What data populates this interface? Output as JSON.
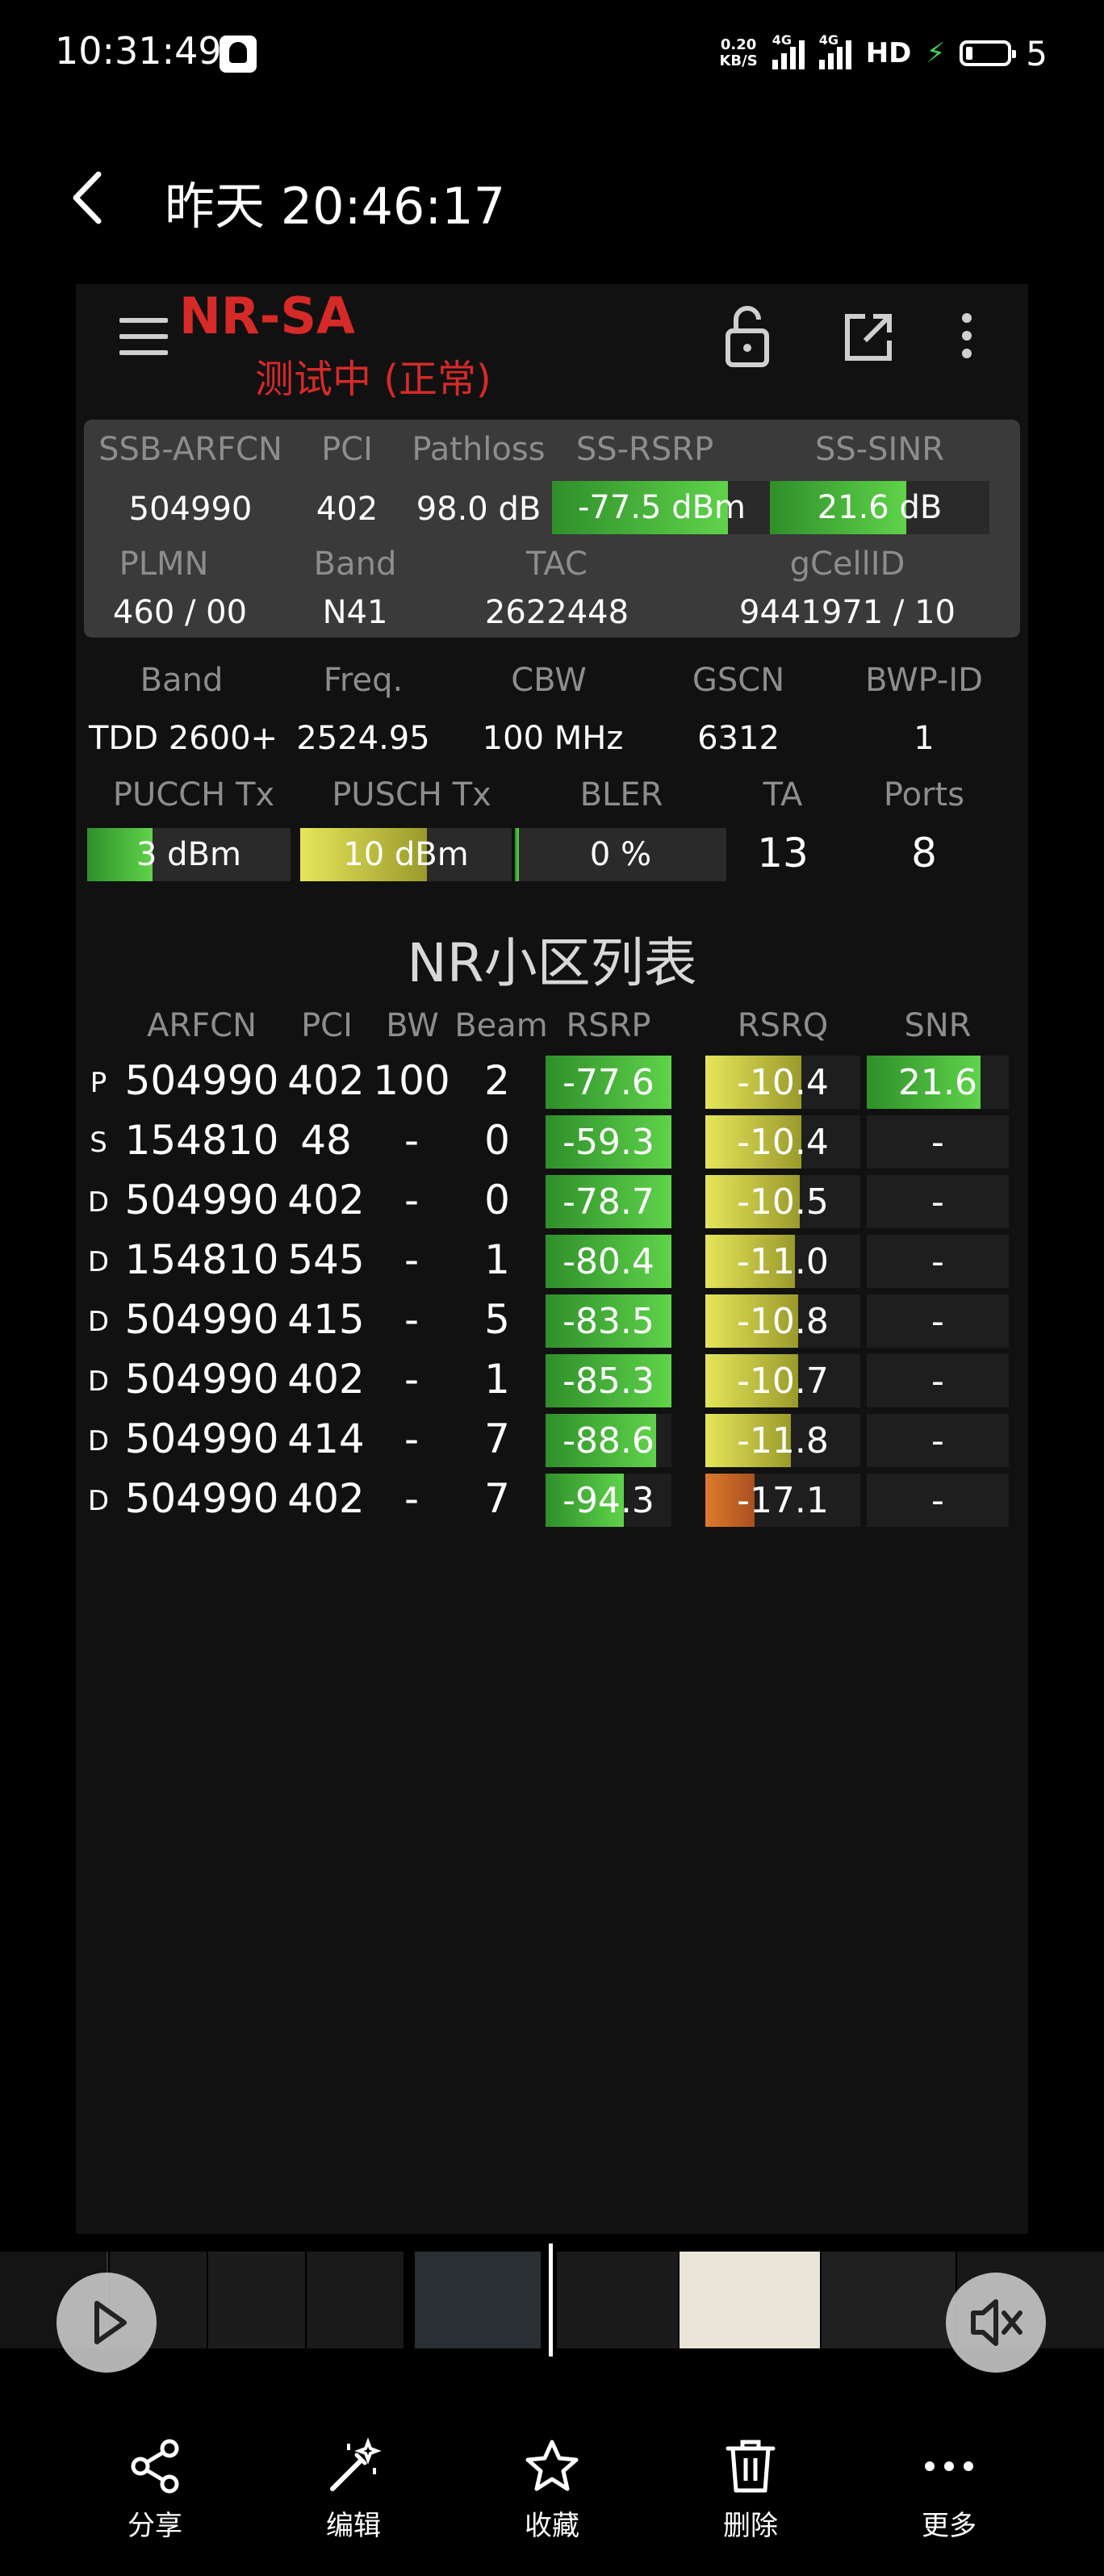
{
  "status_bar": {
    "time": "10:31:49",
    "net_speed_value": "0.20",
    "net_speed_unit": "KB/S",
    "sig1_label": "4G",
    "sig2_label": "4G",
    "hd_label": "HD",
    "battery_level": "5"
  },
  "header": {
    "title": "昨天 20:46:17"
  },
  "app": {
    "title": "NR-SA",
    "subtitle": "测试中 (正常)",
    "summary": {
      "labels": [
        "SSB-ARFCN",
        "PCI",
        "Pathloss",
        "SS-RSRP",
        "SS-SINR"
      ],
      "values": [
        "504990",
        "402",
        "98.0 dB",
        "-77.5 dBm",
        "21.6 dB"
      ],
      "rsrp_fill": 0.8,
      "sinr_fill": 0.62,
      "labels2": [
        "PLMN",
        "Band",
        "TAC",
        "gCellID"
      ],
      "values2": [
        "460 / 00",
        "N41",
        "2622448",
        "9441971 / 10"
      ]
    },
    "band_info": {
      "labels": [
        "Band",
        "Freq.",
        "CBW",
        "GSCN",
        "BWP-ID"
      ],
      "values": [
        "TDD 2600+",
        "2524.95",
        "100 MHz",
        "6312",
        "1"
      ]
    },
    "tx_info": {
      "labels": [
        "PUCCH Tx",
        "PUSCH Tx",
        "BLER",
        "TA",
        "Ports"
      ],
      "pucch": "3 dBm",
      "pusch": "10 dBm",
      "bler": "0 %",
      "ta": "13",
      "ports": "8",
      "pucch_fill": 0.32,
      "pusch_fill": 0.6,
      "bler_fill": 0.02
    },
    "cell_list": {
      "title": "NR小区列表",
      "headers": [
        "ARFCN",
        "PCI",
        "BW",
        "Beam",
        "RSRP",
        "RSRQ",
        "SNR"
      ],
      "rows": [
        {
          "type": "P",
          "arfcn": "504990",
          "pci": "402",
          "bw": "100",
          "beam": "2",
          "rsrp": "-77.6",
          "rsrq": "-10.4",
          "snr": "21.6",
          "rsrp_fill": 1.0,
          "rsrq_fill": 0.62,
          "snr_fill": 0.8
        },
        {
          "type": "S",
          "arfcn": "154810",
          "pci": "48",
          "bw": "-",
          "beam": "0",
          "rsrp": "-59.3",
          "rsrq": "-10.4",
          "snr": "-",
          "rsrp_fill": 1.0,
          "rsrq_fill": 0.62,
          "snr_fill": 0
        },
        {
          "type": "D",
          "arfcn": "504990",
          "pci": "402",
          "bw": "-",
          "beam": "0",
          "rsrp": "-78.7",
          "rsrq": "-10.5",
          "snr": "-",
          "rsrp_fill": 1.0,
          "rsrq_fill": 0.61,
          "snr_fill": 0
        },
        {
          "type": "D",
          "arfcn": "154810",
          "pci": "545",
          "bw": "-",
          "beam": "1",
          "rsrp": "-80.4",
          "rsrq": "-11.0",
          "snr": "-",
          "rsrp_fill": 1.0,
          "rsrq_fill": 0.58,
          "snr_fill": 0
        },
        {
          "type": "D",
          "arfcn": "504990",
          "pci": "415",
          "bw": "-",
          "beam": "5",
          "rsrp": "-83.5",
          "rsrq": "-10.8",
          "snr": "-",
          "rsrp_fill": 1.0,
          "rsrq_fill": 0.6,
          "snr_fill": 0
        },
        {
          "type": "D",
          "arfcn": "504990",
          "pci": "402",
          "bw": "-",
          "beam": "1",
          "rsrp": "-85.3",
          "rsrq": "-10.7",
          "snr": "-",
          "rsrp_fill": 1.0,
          "rsrq_fill": 0.6,
          "snr_fill": 0
        },
        {
          "type": "D",
          "arfcn": "504990",
          "pci": "414",
          "bw": "-",
          "beam": "7",
          "rsrp": "-88.6",
          "rsrq": "-11.8",
          "snr": "-",
          "rsrp_fill": 0.88,
          "rsrq_fill": 0.55,
          "snr_fill": 0
        },
        {
          "type": "D",
          "arfcn": "504990",
          "pci": "402",
          "bw": "-",
          "beam": "7",
          "rsrp": "-94.3",
          "rsrq": "-17.1",
          "snr": "-",
          "rsrp_fill": 0.62,
          "rsrq_fill": 0.32,
          "snr_fill": 0
        }
      ]
    }
  },
  "toolbar": {
    "share": "分享",
    "edit": "编辑",
    "favorite": "收藏",
    "delete": "删除",
    "more": "更多"
  },
  "colors": {
    "accent_red": "#d62a28",
    "green": "#46c43c",
    "yellow": "#d8d848",
    "orange": "#d0702a"
  }
}
